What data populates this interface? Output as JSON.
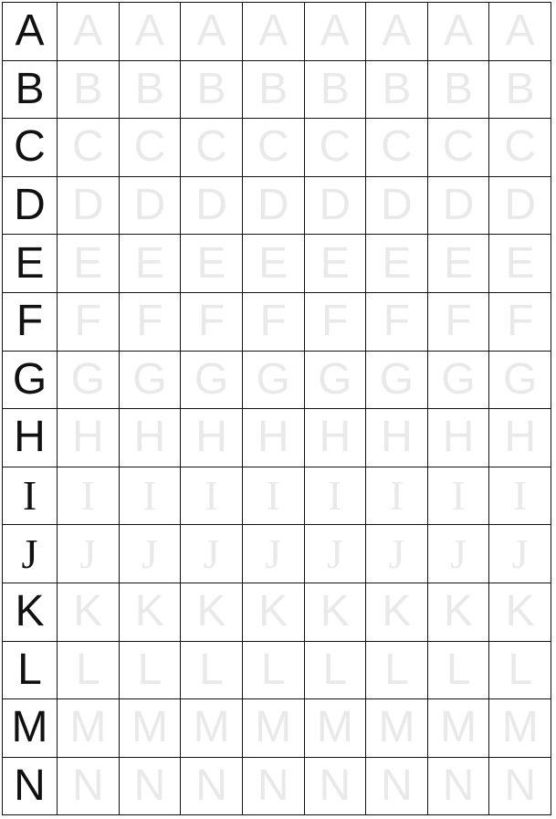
{
  "worksheet": {
    "tracing_copies": 8,
    "colors": {
      "model": "#111111",
      "trace": "#e9e9e9",
      "grid": "#111111"
    },
    "rows": [
      {
        "letter": "A",
        "style": "sans"
      },
      {
        "letter": "B",
        "style": "sans"
      },
      {
        "letter": "C",
        "style": "sans"
      },
      {
        "letter": "D",
        "style": "sans"
      },
      {
        "letter": "E",
        "style": "sans"
      },
      {
        "letter": "F",
        "style": "sans"
      },
      {
        "letter": "G",
        "style": "sans"
      },
      {
        "letter": "H",
        "style": "sans"
      },
      {
        "letter": "I",
        "style": "serif"
      },
      {
        "letter": "J",
        "style": "serif"
      },
      {
        "letter": "K",
        "style": "sans"
      },
      {
        "letter": "L",
        "style": "sans"
      },
      {
        "letter": "M",
        "style": "sans"
      },
      {
        "letter": "N",
        "style": "sans"
      }
    ]
  }
}
